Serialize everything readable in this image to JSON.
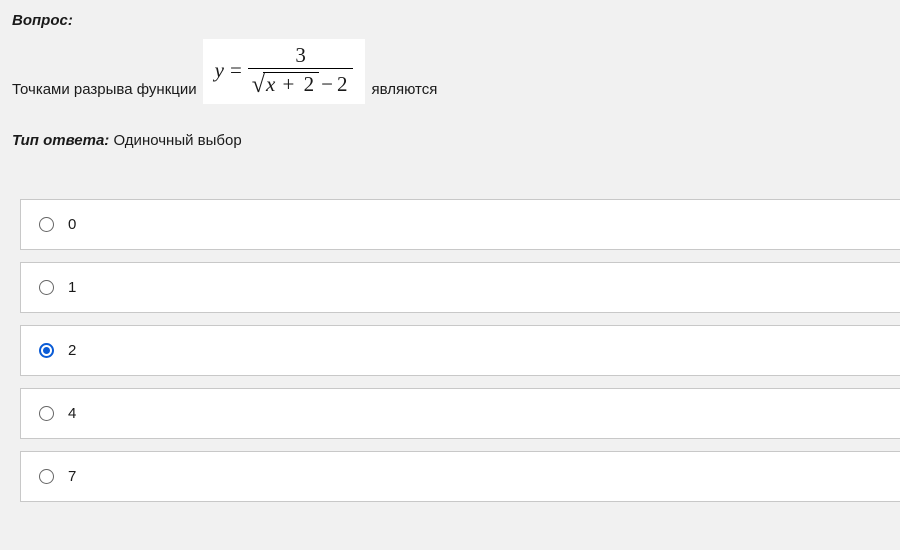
{
  "question": {
    "label": "Вопрос:",
    "text_before": "Точками разрыва функции",
    "text_after": "являются",
    "formula": {
      "lhs": "y",
      "eq": "=",
      "numerator": "3",
      "radicand_var": "x",
      "radicand_plus": "+",
      "radicand_const": "2",
      "outer_minus": "−",
      "outer_const": "2"
    }
  },
  "answer_type": {
    "label": "Тип ответа:",
    "value": "Одиночный выбор"
  },
  "options": [
    {
      "label": "0",
      "selected": false
    },
    {
      "label": "1",
      "selected": false
    },
    {
      "label": "2",
      "selected": true
    },
    {
      "label": "4",
      "selected": false
    },
    {
      "label": "7",
      "selected": false
    }
  ]
}
